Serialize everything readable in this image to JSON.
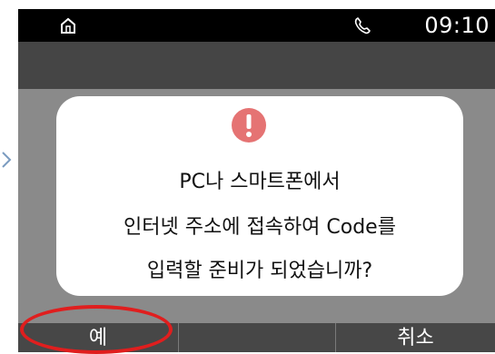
{
  "status_bar": {
    "home_icon": "home-icon",
    "phone_icon": "phone-icon",
    "time": "09:10"
  },
  "dialog": {
    "icon": "alert-icon",
    "icon_color": "#e57373",
    "lines": [
      "PC나 스마트폰에서",
      "인터넷 주소에 접속하여 Code를",
      "입력할 준비가 되었습니까?"
    ]
  },
  "softkeys": {
    "left_label": "예",
    "middle_label": "",
    "right_label": "취소"
  },
  "colors": {
    "highlight": "#e01e1e",
    "screen_bg": "#8a8a8a",
    "softkey_bg": "#474747"
  }
}
